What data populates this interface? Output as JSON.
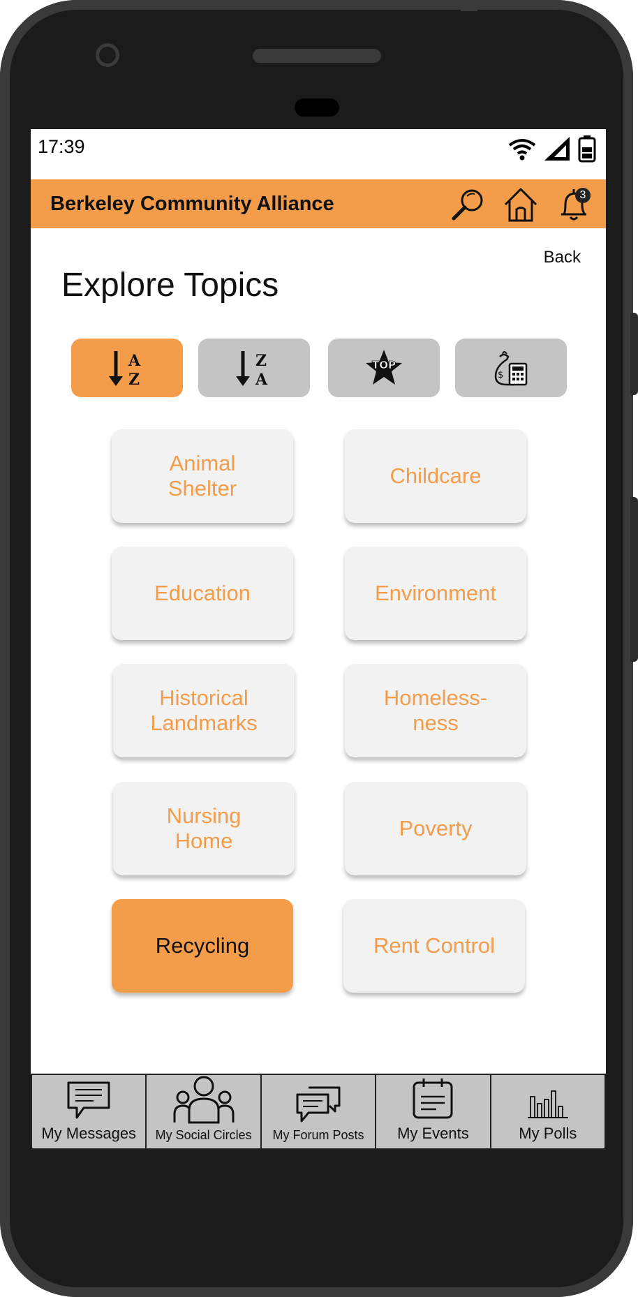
{
  "status": {
    "time": "17:39"
  },
  "appbar": {
    "title": "Berkeley Community Alliance",
    "notification_count": "3"
  },
  "page": {
    "back_label": "Back",
    "title": "Explore Topics"
  },
  "sort_buttons": [
    {
      "name": "sort-a-z",
      "top": "A",
      "bottom": "Z",
      "active": true
    },
    {
      "name": "sort-z-a",
      "top": "Z",
      "bottom": "A",
      "active": false
    },
    {
      "name": "sort-top",
      "label": "TOP",
      "active": false
    },
    {
      "name": "sort-funding",
      "active": false
    }
  ],
  "topics": [
    {
      "label": "Animal Shelter",
      "lines": [
        "Animal",
        "Shelter"
      ]
    },
    {
      "label": "Childcare",
      "lines": [
        "Childcare"
      ]
    },
    {
      "label": "Education",
      "lines": [
        "Education"
      ]
    },
    {
      "label": "Environment",
      "lines": [
        "Environment"
      ]
    },
    {
      "label": "Historical Landmarks",
      "lines": [
        "Historical",
        "Landmarks"
      ]
    },
    {
      "label": "Homelessness",
      "lines": [
        "Homeless-",
        "ness"
      ]
    },
    {
      "label": "Nursing Home",
      "lines": [
        "Nursing",
        "Home"
      ]
    },
    {
      "label": "Poverty",
      "lines": [
        "Poverty"
      ]
    },
    {
      "label": "Recycling",
      "lines": [
        "Recycling"
      ],
      "selected": true
    },
    {
      "label": "Rent Control",
      "lines": [
        "Rent Control"
      ]
    }
  ],
  "bottom_nav": [
    {
      "label": "My Messages",
      "icon": "message-icon"
    },
    {
      "label": "My Social Circles",
      "icon": "people-icon"
    },
    {
      "label": "My Forum Posts",
      "icon": "forum-icon"
    },
    {
      "label": "My Events",
      "icon": "calendar-icon"
    },
    {
      "label": "My Polls",
      "icon": "poll-icon"
    }
  ],
  "colors": {
    "accent": "#f39c4a",
    "tile": "#f2f2f2",
    "inactive": "#c4c4c4"
  }
}
